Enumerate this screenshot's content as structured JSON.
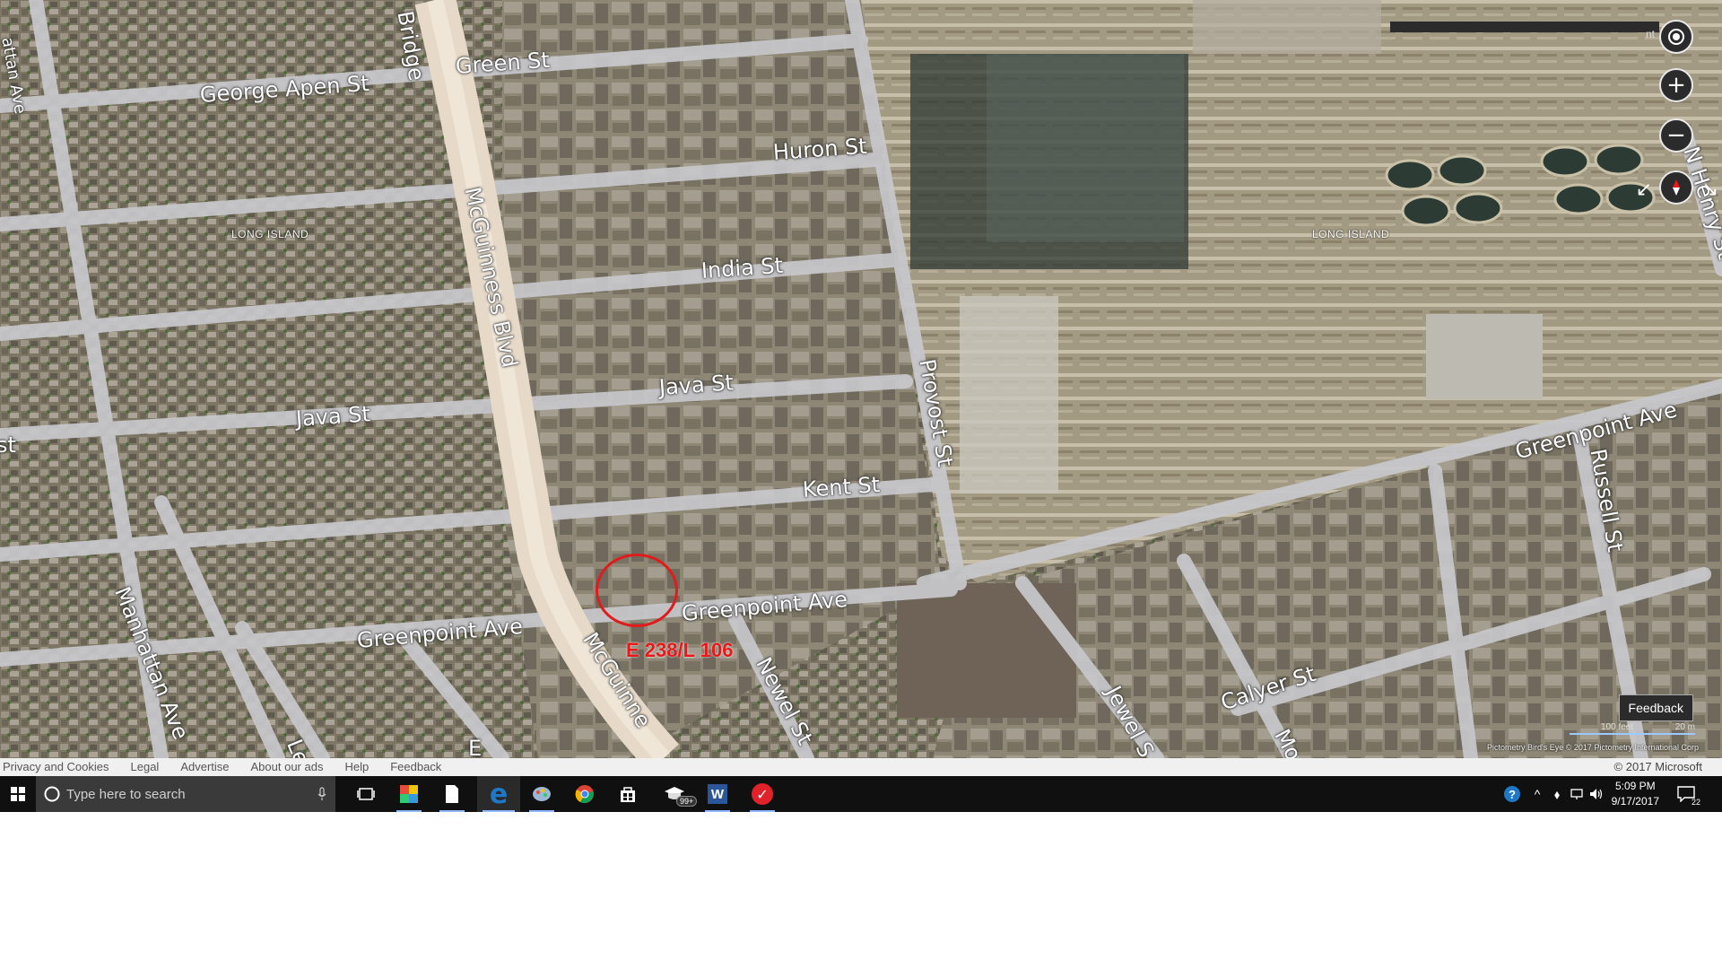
{
  "map": {
    "streets": [
      {
        "id": "george-apen-st",
        "label": "George Apen St"
      },
      {
        "id": "green-st",
        "label": "Green St"
      },
      {
        "id": "bridge",
        "label": "Bridge"
      },
      {
        "id": "huron-st",
        "label": "Huron St"
      },
      {
        "id": "mcguinness-blvd",
        "label": "McGuinness Blvd"
      },
      {
        "id": "india-st",
        "label": "India St"
      },
      {
        "id": "java-st-east",
        "label": "Java St"
      },
      {
        "id": "java-st-west",
        "label": "Java St"
      },
      {
        "id": "kent-st",
        "label": "Kent St"
      },
      {
        "id": "provost-st",
        "label": "Provost St"
      },
      {
        "id": "greenpoint-ave-west",
        "label": "Greenpoint Ave"
      },
      {
        "id": "greenpoint-ave-mid",
        "label": "Greenpoint Ave"
      },
      {
        "id": "greenpoint-ave-east",
        "label": "Greenpoint Ave"
      },
      {
        "id": "manhattan-ave",
        "label": "Manhattan Ave"
      },
      {
        "id": "mcguinness-lower",
        "label": "McGuinne"
      },
      {
        "id": "newel-st",
        "label": "Newel St"
      },
      {
        "id": "jewel-st",
        "label": "Jewel S"
      },
      {
        "id": "calyer-st",
        "label": "Calyer St"
      },
      {
        "id": "russell-st",
        "label": "Russell St"
      },
      {
        "id": "n-henry-st",
        "label": "N Henry St"
      },
      {
        "id": "manhattan-ave-top",
        "label": "attan Ave"
      },
      {
        "id": "st-left",
        "label": "st"
      },
      {
        "id": "le",
        "label": "Le"
      },
      {
        "id": "e",
        "label": "E"
      },
      {
        "id": "mo",
        "label": "Mo"
      }
    ],
    "areas": [
      {
        "id": "long-island-west",
        "label": "LONG ISLAND"
      },
      {
        "id": "long-island-east",
        "label": "LONG ISLAND"
      }
    ],
    "annotation": {
      "label": "E 238/L 106",
      "color": "#e8181b"
    },
    "controls": {
      "locate_icon": "target-icon",
      "zoom_in": "+",
      "zoom_out": "−",
      "compass_icon": "compass-icon",
      "feedback": "Feedback",
      "partial_label": "nt"
    },
    "scale": {
      "feet": "100 feet",
      "meters": "20 m"
    },
    "attribution": "Pictometry Bird's Eye © 2017 Pictometry International Corp"
  },
  "footer": {
    "links": [
      "Privacy and Cookies",
      "Legal",
      "Advertise",
      "About our ads",
      "Help",
      "Feedback"
    ],
    "copyright": "© 2017 Microsoft"
  },
  "taskbar": {
    "search_placeholder": "Type here to search",
    "badge": "99+",
    "time": "5:09 PM",
    "date": "9/17/2017",
    "notifications": "22"
  },
  "colors": {
    "taskbar": "#101010",
    "accent": "#e8181b",
    "edge": "#1e78c8"
  }
}
